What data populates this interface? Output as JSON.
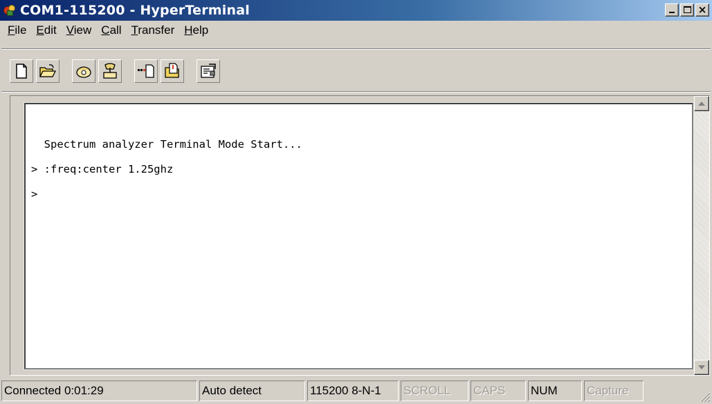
{
  "window": {
    "title": "COM1-115200 - HyperTerminal"
  },
  "menu": {
    "items": [
      {
        "label": "File",
        "accel": "F",
        "rest": "ile"
      },
      {
        "label": "Edit",
        "accel": "E",
        "rest": "dit"
      },
      {
        "label": "View",
        "accel": "V",
        "rest": "iew"
      },
      {
        "label": "Call",
        "accel": "C",
        "rest": "all"
      },
      {
        "label": "Transfer",
        "accel": "T",
        "rest": "ransfer"
      },
      {
        "label": "Help",
        "accel": "H",
        "rest": "elp"
      }
    ]
  },
  "toolbar": {
    "buttons": [
      "new-icon",
      "open-icon",
      "connect-icon",
      "disconnect-icon",
      "send-icon",
      "receive-icon",
      "properties-icon"
    ]
  },
  "terminal": {
    "lines": [
      "  Spectrum analyzer Terminal Mode Start...",
      "> :freq:center 1.25ghz",
      ">"
    ]
  },
  "status": {
    "connected": "Connected 0:01:29",
    "detect": "Auto detect",
    "settings": "115200 8-N-1",
    "scroll": "SCROLL",
    "caps": "CAPS",
    "num": "NUM",
    "capture": "Capture"
  },
  "colors": {
    "titlebar_start": "#0a246a",
    "titlebar_end": "#a6caf0",
    "chrome": "#d4d0c8",
    "terminal_bg": "#ffffff"
  }
}
